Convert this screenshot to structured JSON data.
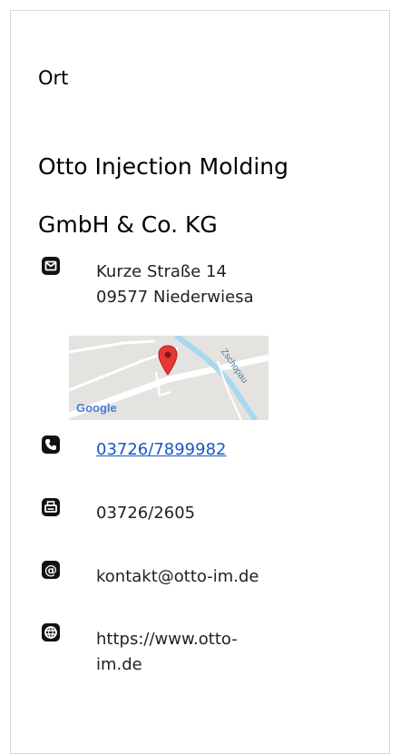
{
  "section": {
    "label": "Ort"
  },
  "company": {
    "line1": "Otto Injection Molding",
    "line2": "GmbH & Co. KG"
  },
  "address": {
    "street": "Kurze Straße 14",
    "city": "09577 Niederwiesa"
  },
  "map": {
    "river_label": "Zschopau",
    "brand_label": "Google"
  },
  "contact": {
    "phone": "03726/7899982",
    "fax": "03726/2605",
    "email": "kontakt@otto-im.de",
    "website_line1": "https://www.otto-",
    "website_line2": "im.de"
  },
  "icons": {
    "address": "envelope-icon",
    "phone": "phone-icon",
    "fax": "fax-icon",
    "email": "at-sign-icon",
    "website": "globe-icon"
  },
  "colors": {
    "link": "#1a56c8",
    "map_pin": "#e53935",
    "river": "#a8d8f0"
  }
}
